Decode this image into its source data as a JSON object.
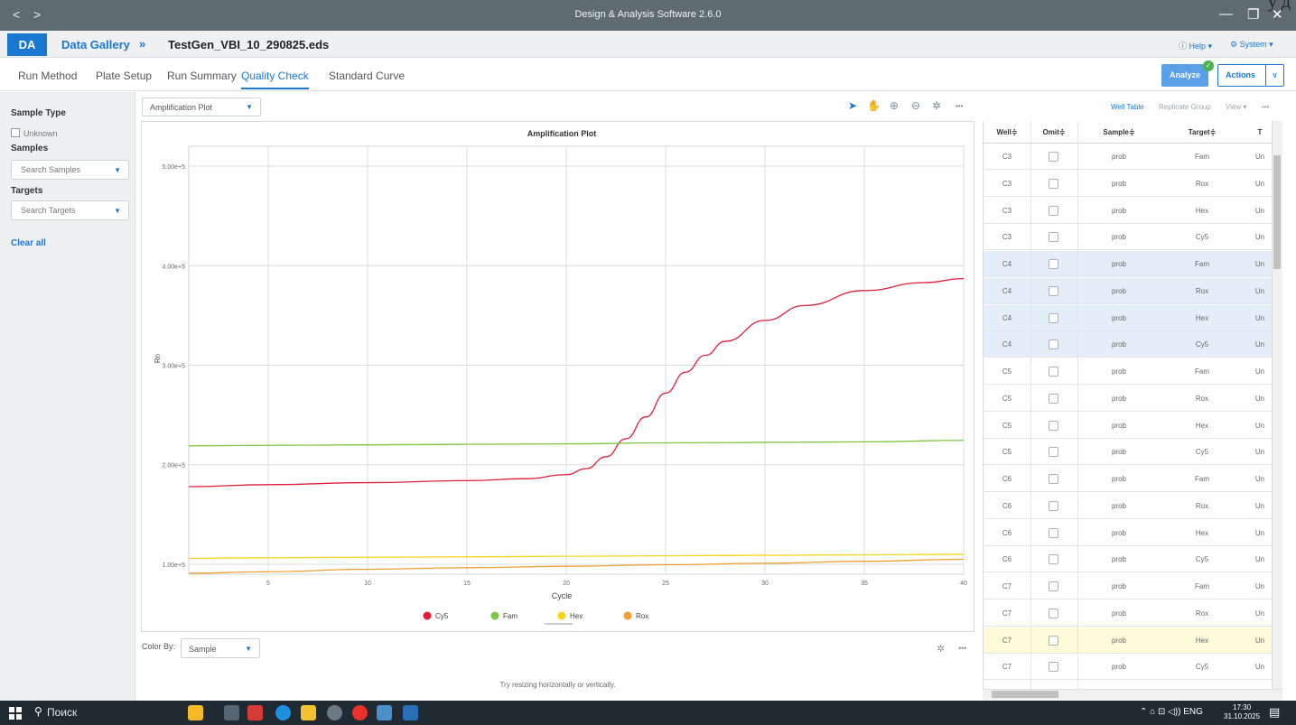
{
  "window": {
    "title": "Design & Analysis Software 2.6.0",
    "nav_back": "<",
    "nav_forward": ">",
    "minimize": "—",
    "maximize": "❐",
    "close": "✕",
    "cutoff_text": "у д"
  },
  "header": {
    "logo": "DA",
    "gallery": "Data Gallery",
    "separator": "»",
    "file": "TestGen_VBI_10_290825.eds",
    "help": "ⓘ Help ▾",
    "system": "⚙ System ▾"
  },
  "tabs": [
    {
      "label": "Run Method"
    },
    {
      "label": "Plate Setup"
    },
    {
      "label": "Run Summary"
    },
    {
      "label": "Quality Check"
    },
    {
      "label": "Standard Curve"
    }
  ],
  "toolbar": {
    "analyze": "Analyze",
    "actions": "Actions",
    "actions_arrow": "∨"
  },
  "left_panel": {
    "sample_type": "Sample Type",
    "unknown": "Unknown",
    "samples": "Samples",
    "search_samples": "Search Samples",
    "targets": "Targets",
    "search_targets": "Search Targets",
    "clear_all": "Clear all",
    "arrow": "▼"
  },
  "plot_controls": {
    "plot_type": "Amplification Plot",
    "tools": [
      {
        "icon": "pointer-icon",
        "glyph": "➤"
      },
      {
        "icon": "pan-icon",
        "glyph": "✋"
      },
      {
        "icon": "zoom-in-icon",
        "glyph": "⊕"
      },
      {
        "icon": "zoom-out-icon",
        "glyph": "⊖"
      },
      {
        "icon": "gear-icon",
        "glyph": "✲"
      },
      {
        "icon": "more-icon",
        "glyph": "•••"
      }
    ]
  },
  "chart_data": {
    "type": "line",
    "title": "Amplification Plot",
    "xlabel": "Cycle",
    "ylabel": "Rn",
    "xlim": [
      1,
      40
    ],
    "ylim": [
      90000,
      520000
    ],
    "x_ticks": [
      5,
      10,
      15,
      20,
      25,
      30,
      35,
      40
    ],
    "y_ticks": [
      100000,
      200000,
      300000,
      400000,
      500000
    ],
    "y_tick_labels": [
      "1.00e+5",
      "2.00e+5",
      "3.00e+5",
      "4.00e+5",
      "5.00e+5"
    ],
    "grid": true,
    "legend_position": "bottom",
    "series": [
      {
        "name": "Cy5",
        "color": "#e01e3c",
        "x": [
          1,
          5,
          10,
          15,
          18,
          20,
          21,
          22,
          23,
          24,
          25,
          26,
          27,
          28,
          30,
          32,
          35,
          38,
          40
        ],
        "y": [
          178000,
          180000,
          182000,
          184000,
          186000,
          190000,
          196000,
          208000,
          226000,
          248000,
          272000,
          293000,
          310000,
          324000,
          345000,
          360000,
          375000,
          383000,
          387000
        ]
      },
      {
        "name": "Fam",
        "color": "#7ec540",
        "x": [
          1,
          5,
          10,
          15,
          20,
          25,
          30,
          35,
          40
        ],
        "y": [
          219000,
          219500,
          220000,
          220500,
          221000,
          222000,
          222500,
          223000,
          224500
        ]
      },
      {
        "name": "Hex",
        "color": "#f5d51b",
        "x": [
          1,
          5,
          10,
          15,
          20,
          25,
          30,
          35,
          40
        ],
        "y": [
          106000,
          106500,
          107000,
          107500,
          108000,
          108500,
          109000,
          109500,
          110000
        ]
      },
      {
        "name": "Rox",
        "color": "#f0a030",
        "x": [
          1,
          5,
          10,
          15,
          20,
          25,
          30,
          35,
          40
        ],
        "y": [
          91000,
          92500,
          95000,
          96500,
          98000,
          99500,
          101000,
          103000,
          105000
        ]
      }
    ]
  },
  "bottom_panel": {
    "color_by_label": "Color By:",
    "color_by_value": "Sample",
    "hint": "Try resizing horizontally or vertically.",
    "gear": "✲",
    "more": "•••"
  },
  "right_panel": {
    "well_table": "Well Table",
    "replicate_group": "Replicate Group",
    "view": "View ▾",
    "more": "•••",
    "columns": [
      "Well",
      "Omit",
      "Sample",
      "Target",
      "T"
    ],
    "sort_glyph": "≑",
    "rows": [
      {
        "well": "C3",
        "sample": "prob",
        "target": "Fam",
        "task": "Un",
        "highlight": "none"
      },
      {
        "well": "C3",
        "sample": "prob",
        "target": "Rox",
        "task": "Un",
        "highlight": "none"
      },
      {
        "well": "C3",
        "sample": "prob",
        "target": "Hex",
        "task": "Un",
        "highlight": "none"
      },
      {
        "well": "C3",
        "sample": "prob",
        "target": "Cy5",
        "task": "Un",
        "highlight": "none"
      },
      {
        "well": "C4",
        "sample": "prob",
        "target": "Fam",
        "task": "Un",
        "highlight": "blue"
      },
      {
        "well": "C4",
        "sample": "prob",
        "target": "Rox",
        "task": "Un",
        "highlight": "blue"
      },
      {
        "well": "C4",
        "sample": "prob",
        "target": "Hex",
        "task": "Un",
        "highlight": "blue"
      },
      {
        "well": "C4",
        "sample": "prob",
        "target": "Cy5",
        "task": "Un",
        "highlight": "blue"
      },
      {
        "well": "C5",
        "sample": "prob",
        "target": "Fam",
        "task": "Un",
        "highlight": "none"
      },
      {
        "well": "C5",
        "sample": "prob",
        "target": "Rox",
        "task": "Un",
        "highlight": "none"
      },
      {
        "well": "C5",
        "sample": "prob",
        "target": "Hex",
        "task": "Un",
        "highlight": "none"
      },
      {
        "well": "C5",
        "sample": "prob",
        "target": "Cy5",
        "task": "Un",
        "highlight": "none"
      },
      {
        "well": "C6",
        "sample": "prob",
        "target": "Fam",
        "task": "Un",
        "highlight": "none"
      },
      {
        "well": "C6",
        "sample": "prob",
        "target": "Rox",
        "task": "Un",
        "highlight": "none"
      },
      {
        "well": "C6",
        "sample": "prob",
        "target": "Hex",
        "task": "Un",
        "highlight": "none"
      },
      {
        "well": "C6",
        "sample": "prob",
        "target": "Cy5",
        "task": "Un",
        "highlight": "none"
      },
      {
        "well": "C7",
        "sample": "prob",
        "target": "Fam",
        "task": "Un",
        "highlight": "none"
      },
      {
        "well": "C7",
        "sample": "prob",
        "target": "Rox",
        "task": "Un",
        "highlight": "none"
      },
      {
        "well": "C7",
        "sample": "prob",
        "target": "Hex",
        "task": "Un",
        "highlight": "yellow"
      },
      {
        "well": "C7",
        "sample": "prob",
        "target": "Cy5",
        "task": "Un",
        "highlight": "none"
      }
    ]
  },
  "taskbar": {
    "search": "Поиск",
    "tray": "⌃  ⌂  ⊡  ◁))  ENG",
    "time": "17:30",
    "date": "31.10.2025"
  },
  "colors": {
    "accent": "#1b78d0",
    "titlebar": "#5e6b73",
    "row_blue": "#e3eef8",
    "row_yellow": "#fdfbd8"
  }
}
